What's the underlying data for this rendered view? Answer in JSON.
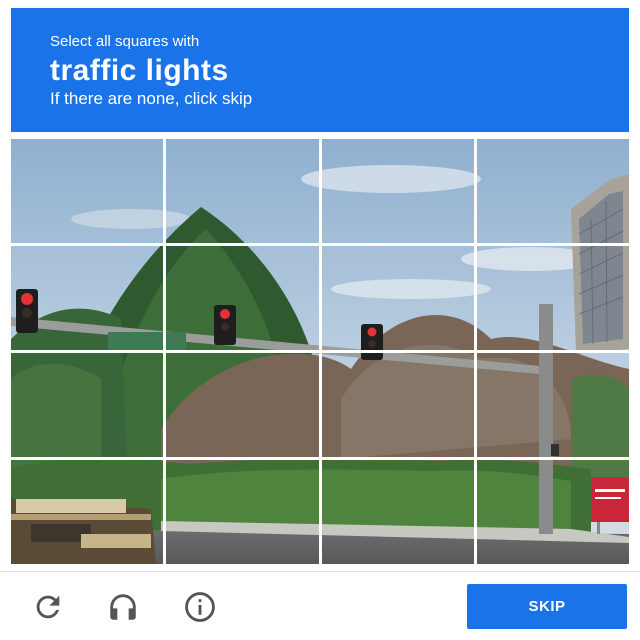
{
  "header": {
    "instruction": "Select all squares with",
    "target": "traffic lights",
    "hint": "If there are none, click skip",
    "background_color": "#1a73e8"
  },
  "grid": {
    "rows": 4,
    "columns": 4,
    "selected_tiles": []
  },
  "footer": {
    "reload_icon": "reload-icon",
    "audio_icon": "headphones-icon",
    "info_icon": "info-icon",
    "skip_label": "SKIP"
  }
}
